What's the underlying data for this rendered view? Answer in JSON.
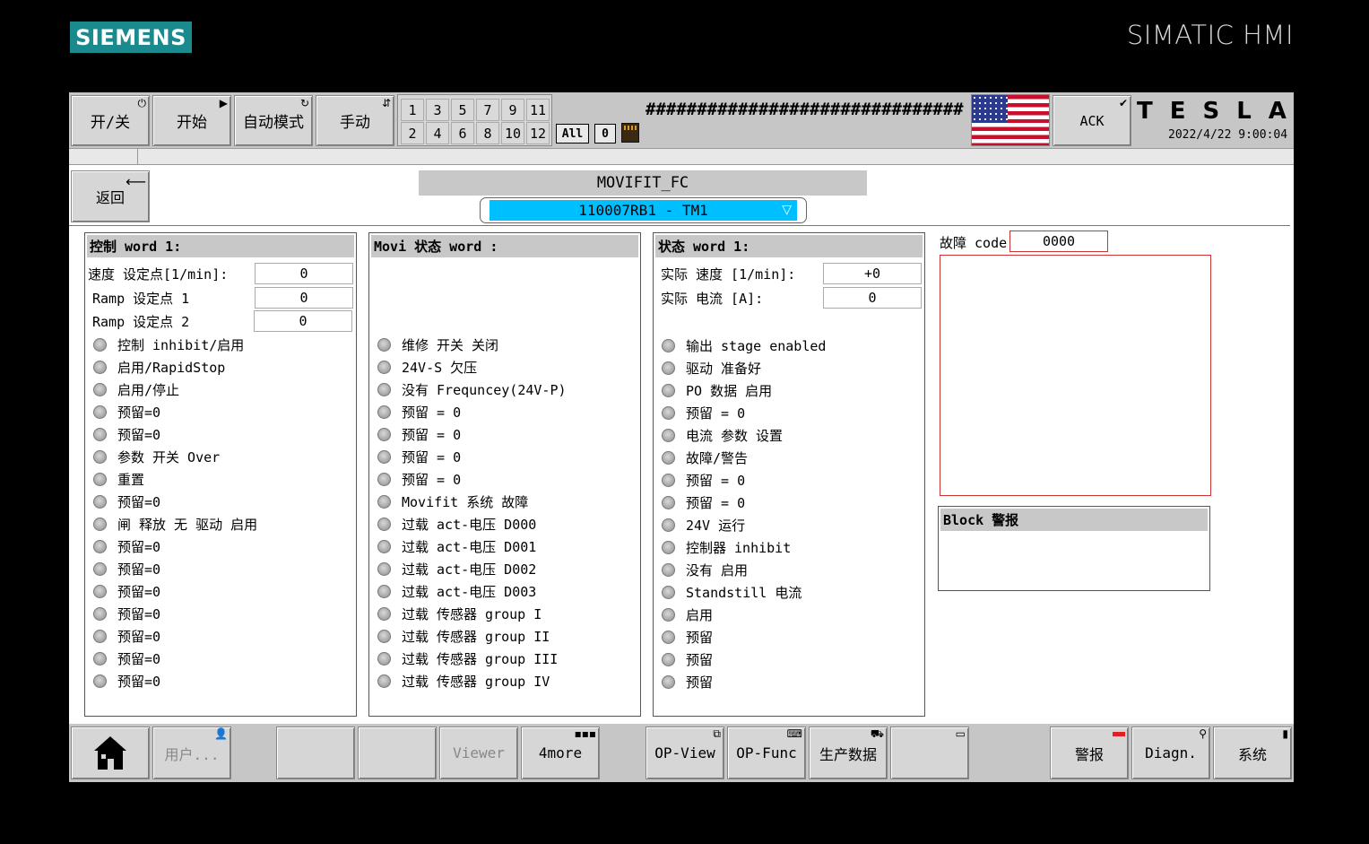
{
  "brand": {
    "logo": "SIEMENS",
    "product": "SIMATIC HMI"
  },
  "topbar": {
    "buttons": [
      {
        "label": "开/关",
        "icon": "power-icon"
      },
      {
        "label": "开始",
        "icon": "play-icon"
      },
      {
        "label": "自动模式",
        "icon": "refresh-icon"
      },
      {
        "label": "手动",
        "icon": "manual-icon"
      }
    ],
    "numbers_top": [
      "1",
      "3",
      "5",
      "7",
      "9",
      "11"
    ],
    "numbers_bottom": [
      "2",
      "4",
      "6",
      "8",
      "10",
      "12"
    ],
    "all_label": "All",
    "count_label": "0",
    "alarm_text": "###############################",
    "ack_label": "ACK",
    "tesla_logo": "TESLA",
    "datetime": "2022/4/22 9:00:04"
  },
  "header": {
    "back_label": "返回",
    "device_title": "MOVIFIT_FC",
    "device_selected": "110007RB1 - TM1"
  },
  "control_panel": {
    "title": "控制 word 1:",
    "fields": [
      {
        "label": "速度 设定点[1/min]:",
        "value": "0"
      },
      {
        "label": "Ramp 设定点 1",
        "value": "0"
      },
      {
        "label": "Ramp 设定点 2",
        "value": "0"
      }
    ],
    "lamps": [
      "控制 inhibit/启用",
      "启用/RapidStop",
      "启用/停止",
      "预留=0",
      "预留=0",
      "参数 开关 Over",
      "重置",
      "预留=0",
      "闸 释放 无 驱动 启用",
      "预留=0",
      "预留=0",
      "预留=0",
      "预留=0",
      "预留=0",
      "预留=0",
      "预留=0"
    ]
  },
  "movi_panel": {
    "title": "Movi 状态 word :",
    "lamps": [
      "维修 开关 关闭",
      "24V-S 欠压",
      "没有 Frequncey(24V-P)",
      "预留 = 0",
      "预留 = 0",
      "预留 = 0",
      "预留 = 0",
      "Movifit 系统 故障",
      "过载 act-电压 D000",
      "过载 act-电压 D001",
      "过载 act-电压 D002",
      "过载 act-电压 D003",
      "过载 传感器 group I",
      "过载 传感器 group II",
      "过载 传感器 group III",
      "过载 传感器 group IV"
    ]
  },
  "status_panel": {
    "title": "状态 word 1:",
    "fields": [
      {
        "label": "实际 速度 [1/min]:",
        "value": "+0"
      },
      {
        "label": "实际 电流 [A]:",
        "value": "0"
      }
    ],
    "lamps": [
      "输出 stage enabled",
      "驱动 准备好",
      "PO 数据 启用",
      "预留 = 0",
      "电流 参数 设置",
      "故障/警告",
      "预留 = 0",
      "预留 = 0",
      "24V 运行",
      "控制器 inhibit",
      "没有 启用",
      "Standstill 电流",
      "启用",
      "预留",
      "预留",
      "预留"
    ]
  },
  "fault": {
    "label": "故障 code",
    "value": "0000"
  },
  "block_alarm": {
    "title": "Block 警报"
  },
  "bottombar": {
    "user_label": "用户...",
    "viewer_label": "Viewer",
    "more_label": "4more",
    "opview_label": "OP-View",
    "opfunc_label": "OP-Func",
    "production_label": "生产数据",
    "alarm_label": "警报",
    "diagn_label": "Diagn.",
    "system_label": "系统"
  }
}
